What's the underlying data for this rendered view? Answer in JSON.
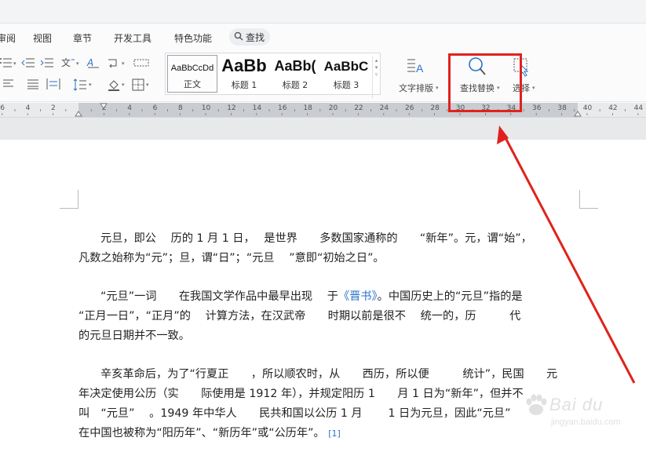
{
  "menubar": {
    "items": [
      "审阅",
      "视图",
      "章节",
      "开发工具",
      "特色功能"
    ],
    "search_label": "查找"
  },
  "ribbon": {
    "styles": [
      {
        "preview": "AaBbCcDd",
        "name": "正文"
      },
      {
        "preview": "AaBb",
        "name": "标题 1"
      },
      {
        "preview": "AaBb(",
        "name": "标题 2"
      },
      {
        "preview": "AaBbC",
        "name": "标题 3"
      }
    ],
    "text_layout_label": "文字排版",
    "find_replace_label": "查找替换",
    "select_label": "选择"
  },
  "ruler": {
    "numbers": [
      "6",
      "4",
      "2",
      "2",
      "4",
      "6",
      "8",
      "10",
      "12",
      "14",
      "16",
      "18",
      "20",
      "22",
      "24",
      "26",
      "28",
      "30",
      "32",
      "34",
      "36",
      "38",
      "40",
      "42",
      "44",
      "46"
    ]
  },
  "document": {
    "paragraphs": [
      {
        "lines": [
          "元旦，即公　 历的 1 月 1 日，　 是世界　　多数国家通称的　　“新年”。元，谓“始”，",
          "凡数之始称为“元”；旦，谓“日”；“元旦　 ”意即“初始之日”。"
        ]
      },
      {
        "lines": [
          "“元旦”一词　　在我国文学作品中最早出现　 于",
          "“正月一日”，“正月”的　 计算方法，在汉武帝　　时期以前是很不　 统一的，历　　　代",
          "的元旦日期并不一致。"
        ],
        "link_text": "《晋书》",
        "after_link": "。中国历史上的“元旦”指的是"
      },
      {
        "lines": [
          "辛亥革命后，为了“行夏正　　，所以顺农时，从　　西历，所以便　　　统计”，民国　　元",
          "年决定使用公历（实　　际使用是 1912 年），并规定阳历 1　　月 1 日为“新年”，但并不",
          "叫　“元旦”　 。1949 年中华人　　民共和国以公历 1 月　　 1 日为元旦，因此“元旦”",
          "在中国也被称为“阳历年”、“新历年”或“公历年”。"
        ],
        "footnote": "[1]"
      }
    ]
  },
  "watermark": {
    "brand": "Bai du",
    "url": "jingyan.baidu.com"
  },
  "colors": {
    "annotation_red": "#e0221c",
    "link_blue": "#2a72c8"
  }
}
